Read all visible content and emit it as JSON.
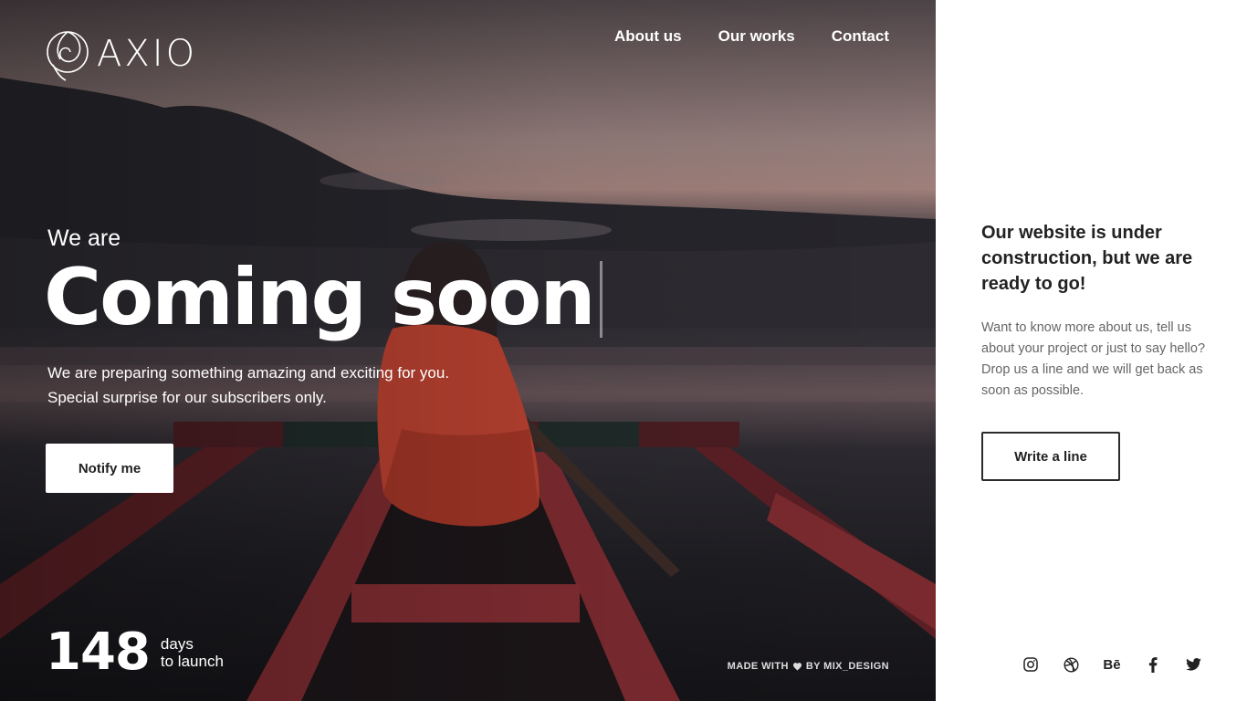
{
  "brand": {
    "name": "AXIO"
  },
  "nav": [
    {
      "label": "About us"
    },
    {
      "label": "Our works"
    },
    {
      "label": "Contact"
    }
  ],
  "hero": {
    "kicker": "We are",
    "headline": "Coming soon",
    "description": [
      "We are preparing something amazing and exciting for you.",
      "Special surprise for our subscribers only."
    ],
    "notify_label": "Notify me"
  },
  "countdown": {
    "value": "148",
    "unit_line1": "days",
    "unit_line2": "to launch"
  },
  "footer": {
    "made_with_prefix": "MADE WITH",
    "made_with_suffix": "BY MIX_DESIGN"
  },
  "panel": {
    "title": "Our website is under construction, but we are ready to go!",
    "body": "Want to know more about us, tell us about your project or just to say hello? Drop us a line and we will get back as soon as possible.",
    "button_label": "Write a line"
  },
  "social": [
    {
      "name": "instagram-icon"
    },
    {
      "name": "dribbble-icon"
    },
    {
      "name": "behance-icon",
      "glyph": "Bē"
    },
    {
      "name": "facebook-icon"
    },
    {
      "name": "twitter-icon"
    }
  ],
  "colors": {
    "panel_bg": "#ffffff",
    "text_dark": "#222222",
    "text_muted": "#666666",
    "hero_text": "#ffffff"
  }
}
